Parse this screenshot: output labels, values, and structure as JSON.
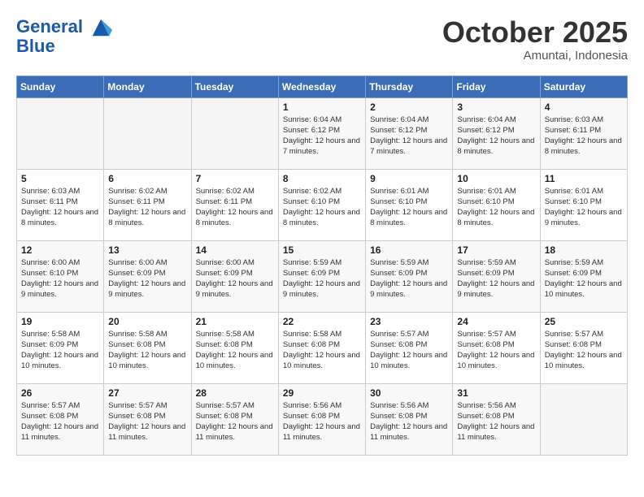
{
  "header": {
    "logo_line1": "General",
    "logo_line2": "Blue",
    "month": "October 2025",
    "location": "Amuntai, Indonesia"
  },
  "weekdays": [
    "Sunday",
    "Monday",
    "Tuesday",
    "Wednesday",
    "Thursday",
    "Friday",
    "Saturday"
  ],
  "weeks": [
    [
      {
        "day": "",
        "sunrise": "",
        "sunset": "",
        "daylight": ""
      },
      {
        "day": "",
        "sunrise": "",
        "sunset": "",
        "daylight": ""
      },
      {
        "day": "",
        "sunrise": "",
        "sunset": "",
        "daylight": ""
      },
      {
        "day": "1",
        "sunrise": "Sunrise: 6:04 AM",
        "sunset": "Sunset: 6:12 PM",
        "daylight": "Daylight: 12 hours and 7 minutes."
      },
      {
        "day": "2",
        "sunrise": "Sunrise: 6:04 AM",
        "sunset": "Sunset: 6:12 PM",
        "daylight": "Daylight: 12 hours and 7 minutes."
      },
      {
        "day": "3",
        "sunrise": "Sunrise: 6:04 AM",
        "sunset": "Sunset: 6:12 PM",
        "daylight": "Daylight: 12 hours and 8 minutes."
      },
      {
        "day": "4",
        "sunrise": "Sunrise: 6:03 AM",
        "sunset": "Sunset: 6:11 PM",
        "daylight": "Daylight: 12 hours and 8 minutes."
      }
    ],
    [
      {
        "day": "5",
        "sunrise": "Sunrise: 6:03 AM",
        "sunset": "Sunset: 6:11 PM",
        "daylight": "Daylight: 12 hours and 8 minutes."
      },
      {
        "day": "6",
        "sunrise": "Sunrise: 6:02 AM",
        "sunset": "Sunset: 6:11 PM",
        "daylight": "Daylight: 12 hours and 8 minutes."
      },
      {
        "day": "7",
        "sunrise": "Sunrise: 6:02 AM",
        "sunset": "Sunset: 6:11 PM",
        "daylight": "Daylight: 12 hours and 8 minutes."
      },
      {
        "day": "8",
        "sunrise": "Sunrise: 6:02 AM",
        "sunset": "Sunset: 6:10 PM",
        "daylight": "Daylight: 12 hours and 8 minutes."
      },
      {
        "day": "9",
        "sunrise": "Sunrise: 6:01 AM",
        "sunset": "Sunset: 6:10 PM",
        "daylight": "Daylight: 12 hours and 8 minutes."
      },
      {
        "day": "10",
        "sunrise": "Sunrise: 6:01 AM",
        "sunset": "Sunset: 6:10 PM",
        "daylight": "Daylight: 12 hours and 8 minutes."
      },
      {
        "day": "11",
        "sunrise": "Sunrise: 6:01 AM",
        "sunset": "Sunset: 6:10 PM",
        "daylight": "Daylight: 12 hours and 9 minutes."
      }
    ],
    [
      {
        "day": "12",
        "sunrise": "Sunrise: 6:00 AM",
        "sunset": "Sunset: 6:10 PM",
        "daylight": "Daylight: 12 hours and 9 minutes."
      },
      {
        "day": "13",
        "sunrise": "Sunrise: 6:00 AM",
        "sunset": "Sunset: 6:09 PM",
        "daylight": "Daylight: 12 hours and 9 minutes."
      },
      {
        "day": "14",
        "sunrise": "Sunrise: 6:00 AM",
        "sunset": "Sunset: 6:09 PM",
        "daylight": "Daylight: 12 hours and 9 minutes."
      },
      {
        "day": "15",
        "sunrise": "Sunrise: 5:59 AM",
        "sunset": "Sunset: 6:09 PM",
        "daylight": "Daylight: 12 hours and 9 minutes."
      },
      {
        "day": "16",
        "sunrise": "Sunrise: 5:59 AM",
        "sunset": "Sunset: 6:09 PM",
        "daylight": "Daylight: 12 hours and 9 minutes."
      },
      {
        "day": "17",
        "sunrise": "Sunrise: 5:59 AM",
        "sunset": "Sunset: 6:09 PM",
        "daylight": "Daylight: 12 hours and 9 minutes."
      },
      {
        "day": "18",
        "sunrise": "Sunrise: 5:59 AM",
        "sunset": "Sunset: 6:09 PM",
        "daylight": "Daylight: 12 hours and 10 minutes."
      }
    ],
    [
      {
        "day": "19",
        "sunrise": "Sunrise: 5:58 AM",
        "sunset": "Sunset: 6:09 PM",
        "daylight": "Daylight: 12 hours and 10 minutes."
      },
      {
        "day": "20",
        "sunrise": "Sunrise: 5:58 AM",
        "sunset": "Sunset: 6:08 PM",
        "daylight": "Daylight: 12 hours and 10 minutes."
      },
      {
        "day": "21",
        "sunrise": "Sunrise: 5:58 AM",
        "sunset": "Sunset: 6:08 PM",
        "daylight": "Daylight: 12 hours and 10 minutes."
      },
      {
        "day": "22",
        "sunrise": "Sunrise: 5:58 AM",
        "sunset": "Sunset: 6:08 PM",
        "daylight": "Daylight: 12 hours and 10 minutes."
      },
      {
        "day": "23",
        "sunrise": "Sunrise: 5:57 AM",
        "sunset": "Sunset: 6:08 PM",
        "daylight": "Daylight: 12 hours and 10 minutes."
      },
      {
        "day": "24",
        "sunrise": "Sunrise: 5:57 AM",
        "sunset": "Sunset: 6:08 PM",
        "daylight": "Daylight: 12 hours and 10 minutes."
      },
      {
        "day": "25",
        "sunrise": "Sunrise: 5:57 AM",
        "sunset": "Sunset: 6:08 PM",
        "daylight": "Daylight: 12 hours and 10 minutes."
      }
    ],
    [
      {
        "day": "26",
        "sunrise": "Sunrise: 5:57 AM",
        "sunset": "Sunset: 6:08 PM",
        "daylight": "Daylight: 12 hours and 11 minutes."
      },
      {
        "day": "27",
        "sunrise": "Sunrise: 5:57 AM",
        "sunset": "Sunset: 6:08 PM",
        "daylight": "Daylight: 12 hours and 11 minutes."
      },
      {
        "day": "28",
        "sunrise": "Sunrise: 5:57 AM",
        "sunset": "Sunset: 6:08 PM",
        "daylight": "Daylight: 12 hours and 11 minutes."
      },
      {
        "day": "29",
        "sunrise": "Sunrise: 5:56 AM",
        "sunset": "Sunset: 6:08 PM",
        "daylight": "Daylight: 12 hours and 11 minutes."
      },
      {
        "day": "30",
        "sunrise": "Sunrise: 5:56 AM",
        "sunset": "Sunset: 6:08 PM",
        "daylight": "Daylight: 12 hours and 11 minutes."
      },
      {
        "day": "31",
        "sunrise": "Sunrise: 5:56 AM",
        "sunset": "Sunset: 6:08 PM",
        "daylight": "Daylight: 12 hours and 11 minutes."
      },
      {
        "day": "",
        "sunrise": "",
        "sunset": "",
        "daylight": ""
      }
    ]
  ]
}
